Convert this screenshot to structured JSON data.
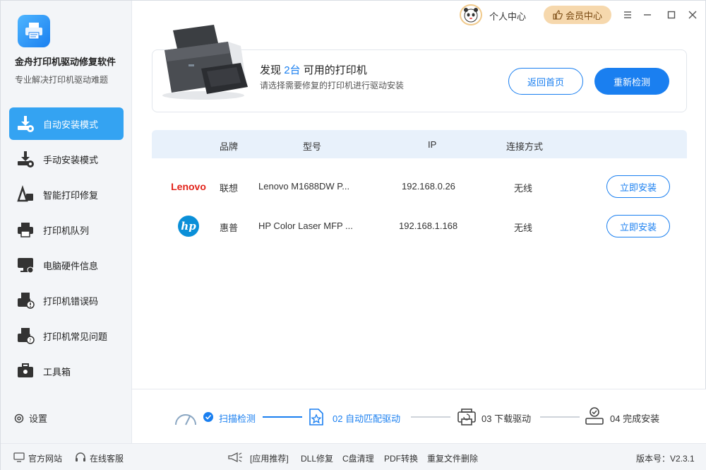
{
  "app": {
    "name": "金舟打印机驱动修复软件",
    "subtitle": "专业解决打印机驱动难题"
  },
  "sidebar": {
    "items": [
      {
        "label": "自动安装模式",
        "icon": "auto-install-icon",
        "active": true
      },
      {
        "label": "手动安装模式",
        "icon": "manual-install-icon",
        "active": false
      },
      {
        "label": "智能打印修复",
        "icon": "smart-repair-icon",
        "active": false
      },
      {
        "label": "打印机队列",
        "icon": "printer-queue-icon",
        "active": false
      },
      {
        "label": "电脑硬件信息",
        "icon": "monitor-icon",
        "active": false
      },
      {
        "label": "打印机错误码",
        "icon": "error-code-icon",
        "active": false
      },
      {
        "label": "打印机常见问题",
        "icon": "faq-icon",
        "active": false
      },
      {
        "label": "工具箱",
        "icon": "toolbox-icon",
        "active": false
      }
    ],
    "settings_label": "设置"
  },
  "titlebar": {
    "user_center": "个人中心",
    "vip_center": "会员中心"
  },
  "found": {
    "prefix": "发现",
    "count": "2台",
    "suffix": "可用的打印机",
    "subtitle": "请选择需要修复的打印机进行驱动安装",
    "home_button": "返回首页",
    "rescan_button": "重新检测"
  },
  "table": {
    "headers": [
      "品牌",
      "型号",
      "IP",
      "连接方式"
    ],
    "rows": [
      {
        "brand_logo": "Lenovo",
        "brand": "联想",
        "model": "Lenovo M1688DW P...",
        "ip": "192.168.0.26",
        "connection": "无线",
        "action": "立即安装"
      },
      {
        "brand_logo": "hp",
        "brand": "惠普",
        "model": "HP Color Laser MFP ...",
        "ip": "192.168.1.168",
        "connection": "无线",
        "action": "立即安装"
      }
    ]
  },
  "steps": [
    {
      "label": "扫描检测",
      "state": "done"
    },
    {
      "label": "02 自动匹配驱动",
      "state": "active"
    },
    {
      "label": "03 下载驱动",
      "state": "pending"
    },
    {
      "label": "04 完成安装",
      "state": "pending"
    }
  ],
  "footer": {
    "website": "官方网站",
    "service": "在线客服",
    "recommend": "[应用推荐]",
    "links": [
      "DLL修复",
      "C盘清理",
      "PDF转换",
      "重复文件删除"
    ],
    "version": "版本号：V2.3.1"
  },
  "colors": {
    "accent": "#1a7ff0",
    "sidebar_active": "#34a3f2",
    "vip": "#f6d8ad"
  }
}
